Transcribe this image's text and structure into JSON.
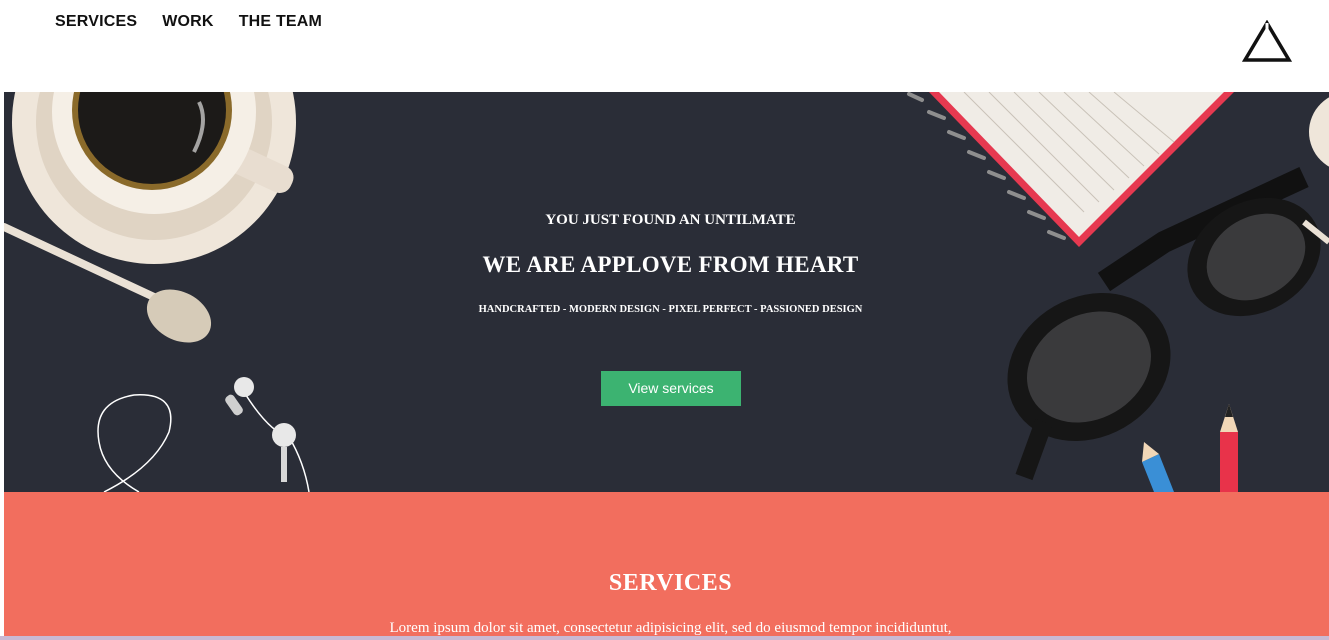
{
  "nav": {
    "items": [
      "SERVICES",
      "WORK",
      "THE TEAM"
    ]
  },
  "logo": {
    "icon": "triangle-logo-icon"
  },
  "hero": {
    "kicker": "YOU JUST FOUND AN UNTILMATE",
    "headline": "WE ARE APPLOVE FROM HEART",
    "tagline": "HANDCRAFTED - MODERN DESIGN - PIXEL PERFECT - PASSIONED DESIGN",
    "cta_label": "View services",
    "illustrations": [
      "coffee-cup-icon",
      "spoon-icon",
      "earphones-icon",
      "notebook-icon",
      "glasses-icon",
      "pencil-icon"
    ]
  },
  "services": {
    "title": "SERVICES",
    "description": "Lorem ipsum dolor sit amet, consectetur adipisicing elit, sed do eiusmod tempor incididuntut,"
  },
  "colors": {
    "hero_bg": "#2a2d37",
    "cta": "#3cb371",
    "services_bg": "#f26e5e"
  }
}
